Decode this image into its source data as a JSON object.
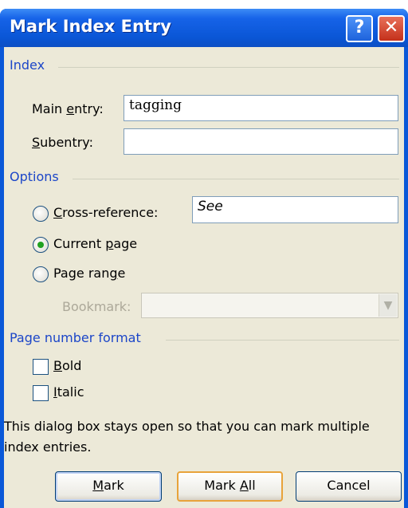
{
  "dialog": {
    "title": "Mark Index Entry",
    "help_glyph": "?",
    "close_glyph": "✕"
  },
  "index_group": {
    "label": "Index",
    "main_entry": {
      "label_pre": "Main ",
      "label_key": "e",
      "label_post": "ntry:",
      "value": "tagging"
    },
    "subentry": {
      "label_pre": "",
      "label_key": "S",
      "label_post": "ubentry:",
      "value": ""
    }
  },
  "options_group": {
    "label": "Options",
    "cross_reference": {
      "label_pre": "",
      "label_key": "C",
      "label_post": "ross-reference:",
      "value": "See",
      "selected": false
    },
    "current_page": {
      "label_pre": "Current ",
      "label_key": "p",
      "label_post": "age",
      "selected": true
    },
    "page_range": {
      "label_pre": "Page ran",
      "label_key": "g",
      "label_post": "e",
      "selected": false
    },
    "bookmark": {
      "label": "Bookmark:",
      "value": ""
    }
  },
  "format_group": {
    "label": "Page number format",
    "bold": {
      "label_key": "B",
      "label_post": "old",
      "checked": false
    },
    "italic": {
      "label_key": "I",
      "label_post": "talic",
      "checked": false
    }
  },
  "note": "This dialog box stays open so that you can mark multiple index entries.",
  "buttons": {
    "mark": {
      "label_key": "M",
      "label_post": "ark"
    },
    "mark_all": {
      "label_pre": "Mark ",
      "label_key": "A",
      "label_post": "ll"
    },
    "cancel": {
      "label": "Cancel"
    }
  },
  "colors": {
    "title_bar": "#0a56d6",
    "group_label": "#1c46c8",
    "dialog_face": "#ece9d8",
    "close_button": "#c4301a",
    "default_button_border": "#e8a33a"
  }
}
